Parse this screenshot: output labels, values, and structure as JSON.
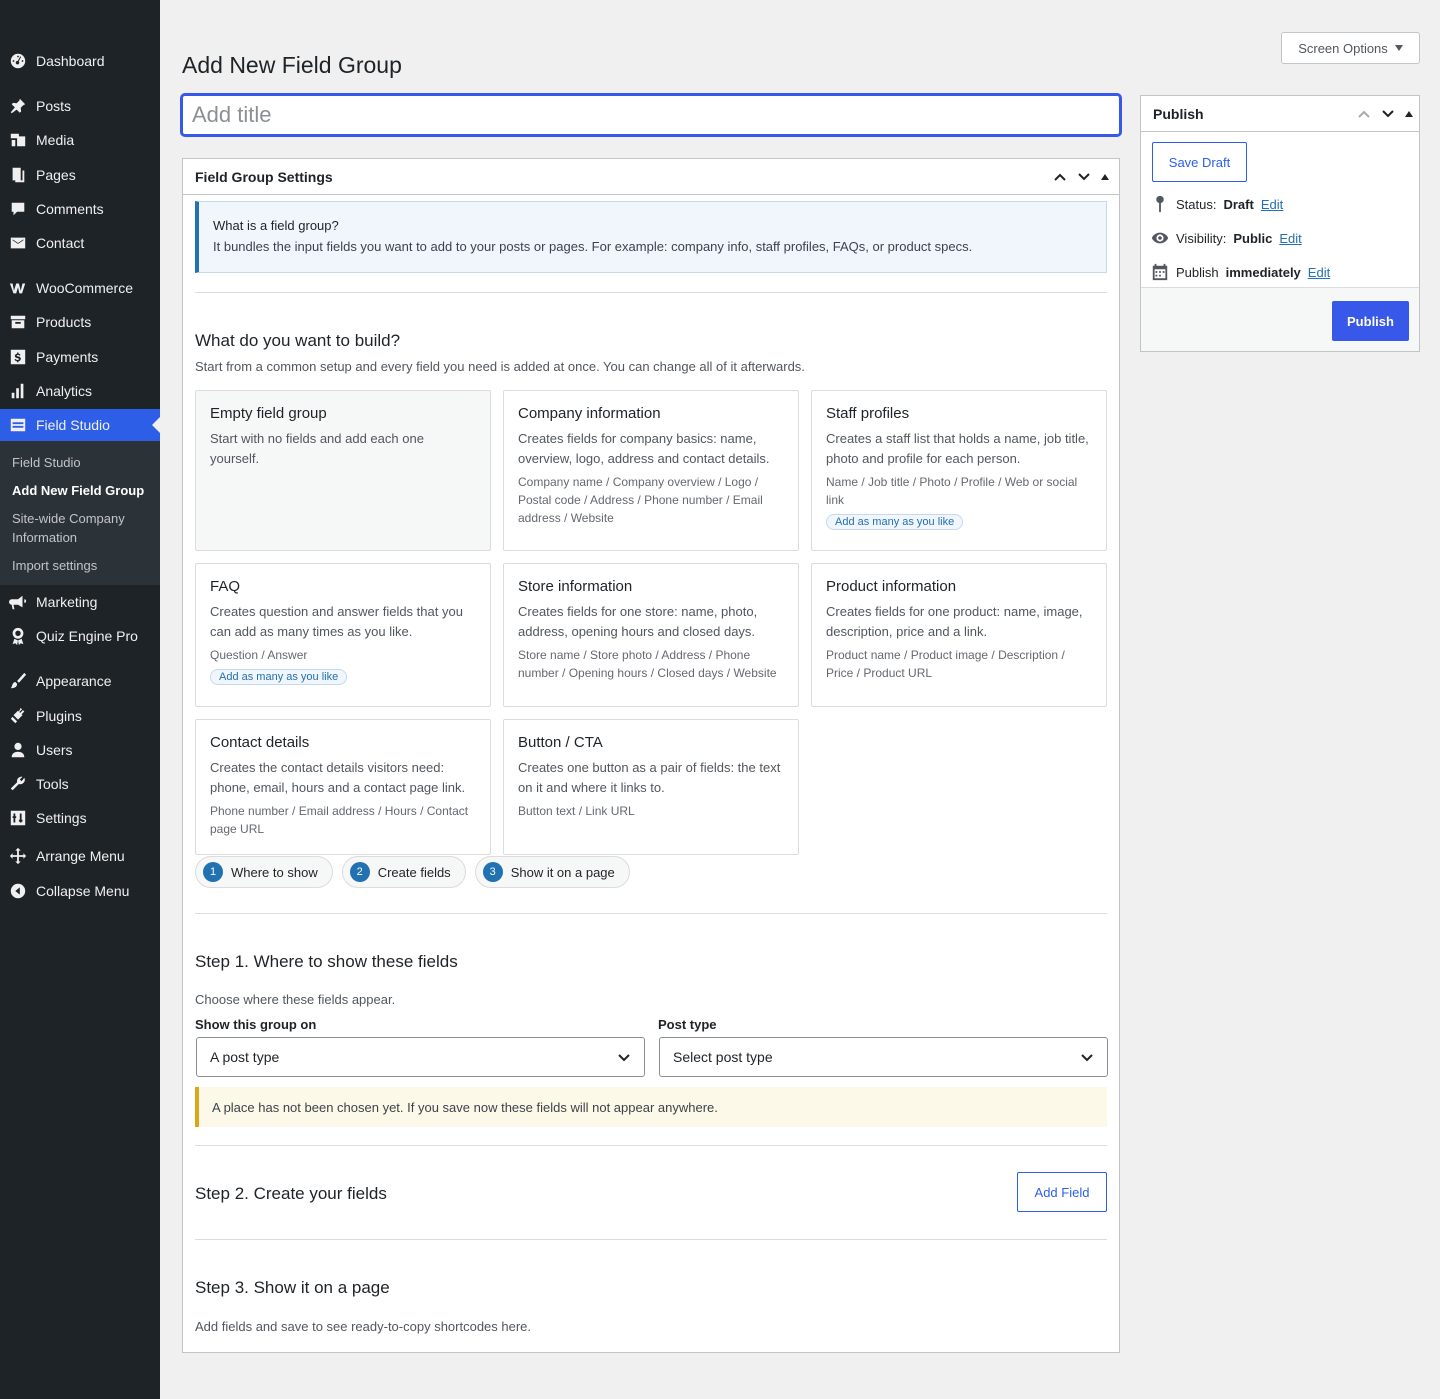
{
  "sidebar": {
    "items": [
      {
        "label": "Dashboard",
        "icon": "dashboard-icon"
      },
      {
        "label": "Posts",
        "icon": "pin-icon"
      },
      {
        "label": "Media",
        "icon": "media-icon"
      },
      {
        "label": "Pages",
        "icon": "page-icon"
      },
      {
        "label": "Comments",
        "icon": "comment-icon"
      },
      {
        "label": "Contact",
        "icon": "envelope-icon"
      },
      {
        "label": "WooCommerce",
        "icon": "woo-icon"
      },
      {
        "label": "Products",
        "icon": "archive-icon"
      },
      {
        "label": "Payments",
        "icon": "dollar-icon"
      },
      {
        "label": "Analytics",
        "icon": "bar-chart-icon"
      },
      {
        "label": "Field Studio",
        "icon": "table-icon"
      },
      {
        "label": "Marketing",
        "icon": "megaphone-icon"
      },
      {
        "label": "Quiz Engine Pro",
        "icon": "award-icon"
      },
      {
        "label": "Appearance",
        "icon": "brush-icon"
      },
      {
        "label": "Plugins",
        "icon": "plug-icon"
      },
      {
        "label": "Users",
        "icon": "user-icon"
      },
      {
        "label": "Tools",
        "icon": "wrench-icon"
      },
      {
        "label": "Settings",
        "icon": "settings-icon"
      },
      {
        "label": "Arrange Menu",
        "icon": "move-icon"
      },
      {
        "label": "Collapse Menu",
        "icon": "collapse-icon"
      }
    ],
    "submenu": [
      {
        "label": "Field Studio"
      },
      {
        "label": "Add New Field Group"
      },
      {
        "label": "Site-wide Company Information"
      },
      {
        "label": "Import settings"
      }
    ]
  },
  "header": {
    "screen_options": "Screen Options",
    "page_title": "Add New Field Group",
    "title_placeholder": "Add title"
  },
  "settings_box": {
    "title": "Field Group Settings",
    "info_title": "What is a field group?",
    "info_text": "It bundles the input fields you want to add to your posts or pages. For example: company info, staff profiles, FAQs, or product specs.",
    "build_heading": "What do you want to build?",
    "build_desc": "Start from a common setup and every field you need is added at once. You can change all of it afterwards.",
    "templates": [
      {
        "title": "Empty field group",
        "desc": "Start with no fields and add each one yourself.",
        "fields": "",
        "badge": ""
      },
      {
        "title": "Company information",
        "desc": "Creates fields for company basics: name, overview, logo, address and contact details.",
        "fields": "Company name / Company overview / Logo / Postal code / Address / Phone number / Email address / Website",
        "badge": ""
      },
      {
        "title": "Staff profiles",
        "desc": "Creates a staff list that holds a name, job title, photo and profile for each person.",
        "fields": "Name / Job title / Photo / Profile / Web or social link",
        "badge": "Add as many as you like"
      },
      {
        "title": "FAQ",
        "desc": "Creates question and answer fields that you can add as many times as you like.",
        "fields": "Question / Answer",
        "badge": "Add as many as you like"
      },
      {
        "title": "Store information",
        "desc": "Creates fields for one store: name, photo, address, opening hours and closed days.",
        "fields": "Store name / Store photo / Address / Phone number / Opening hours / Closed days / Website",
        "badge": ""
      },
      {
        "title": "Product information",
        "desc": "Creates fields for one product: name, image, description, price and a link.",
        "fields": "Product name / Product image / Description / Price / Product URL",
        "badge": ""
      },
      {
        "title": "Contact details",
        "desc": "Creates the contact details visitors need: phone, email, hours and a contact page link.",
        "fields": "Phone number / Email address / Hours / Contact page URL",
        "badge": ""
      },
      {
        "title": "Button / CTA",
        "desc": "Creates one button as a pair of fields: the text on it and where it links to.",
        "fields": "Button text / Link URL",
        "badge": ""
      }
    ],
    "steps": [
      {
        "num": "1",
        "label": "Where to show"
      },
      {
        "num": "2",
        "label": "Create fields"
      },
      {
        "num": "3",
        "label": "Show it on a page"
      }
    ],
    "step1": {
      "heading": "Step 1. Where to show these fields",
      "desc": "Choose where these fields appear.",
      "show_label": "Show this group on",
      "show_value": "A post type",
      "post_type_label": "Post type",
      "post_type_value": "Select post type",
      "warning": "A place has not been chosen yet. If you save now these fields will not appear anywhere."
    },
    "step2": {
      "heading": "Step 2. Create your fields",
      "add_field": "Add Field"
    },
    "step3": {
      "heading": "Step 3. Show it on a page",
      "desc": "Add fields and save to see ready-to-copy shortcodes here."
    }
  },
  "publish": {
    "title": "Publish",
    "save_draft": "Save Draft",
    "status_label": "Status:",
    "status_value": "Draft",
    "visibility_label": "Visibility:",
    "visibility_value": "Public",
    "publish_label": "Publish",
    "publish_value": "immediately",
    "edit": "Edit",
    "publish_button": "Publish"
  },
  "colors": {
    "accent": "#3858e9",
    "sidebar_bg": "#1d2327",
    "current_menu": "#2d5ee8"
  }
}
